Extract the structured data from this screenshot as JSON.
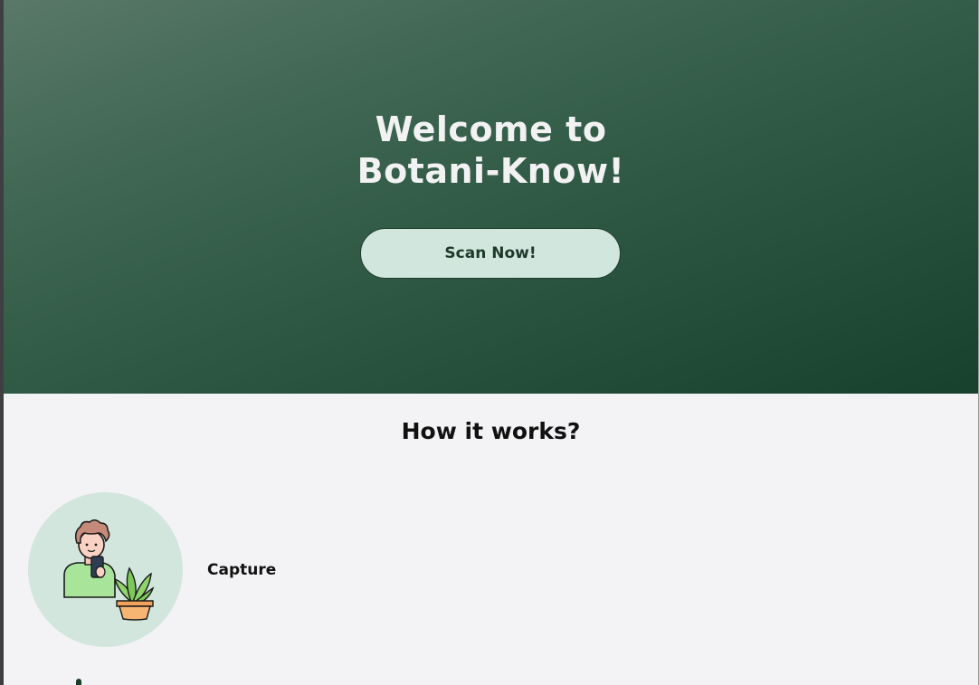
{
  "hero": {
    "title_line1": "Welcome to",
    "title_line2": "Botani-Know!",
    "scan_button_label": "Scan Now!"
  },
  "how_it_works": {
    "title": "How it works?",
    "steps": [
      {
        "label": "Capture",
        "icon": "person-photographing-plant-icon"
      }
    ]
  },
  "colors": {
    "hero_dark": "#17412c",
    "hero_light": "#5a7868",
    "accent_mint": "#d1e6dd",
    "page_background": "#f3f3f5"
  }
}
